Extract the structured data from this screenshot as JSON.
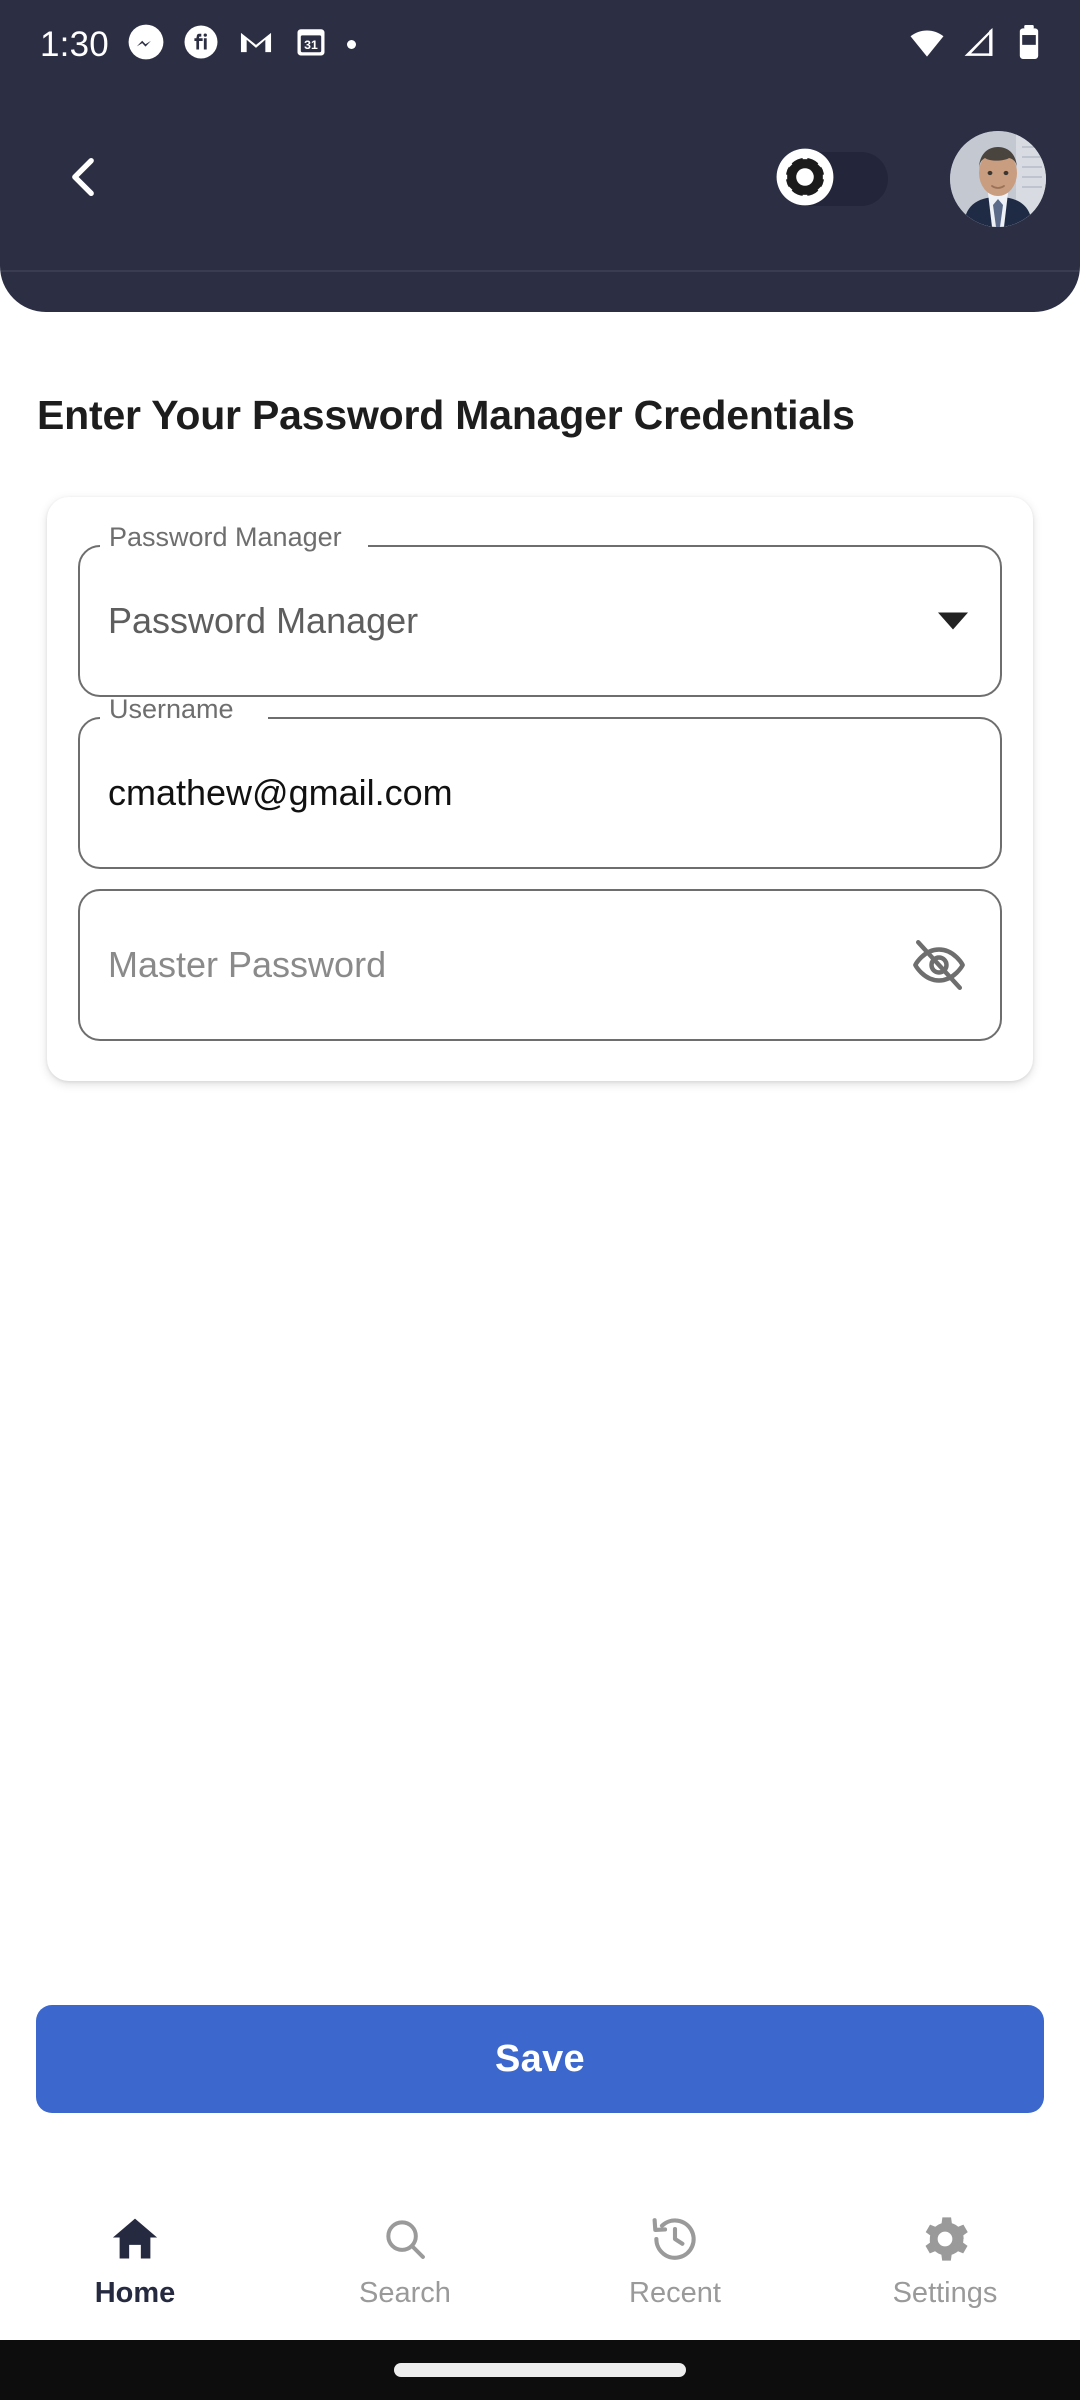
{
  "status_bar": {
    "time": "1:30",
    "left_icons": [
      {
        "name": "messenger-icon"
      },
      {
        "name": "fiverr-icon"
      },
      {
        "name": "gmail-icon"
      },
      {
        "name": "calendar-icon",
        "label": "31"
      },
      {
        "name": "more-notifications-dot-icon"
      }
    ],
    "right_icons": [
      {
        "name": "wifi-icon"
      },
      {
        "name": "cellular-signal-icon"
      },
      {
        "name": "battery-icon"
      }
    ]
  },
  "app_bar": {
    "back_icon": "chevron-left-icon",
    "theme_toggle": {
      "name": "theme-mode-toggle",
      "icon": "brightness-sun-icon",
      "state": "off",
      "track_color": "#23263a"
    },
    "avatar": {
      "name": "user-avatar",
      "alt": "User profile photo"
    },
    "background_color": "#2c2f44"
  },
  "main": {
    "page_title": "Enter Your Password Manager Credentials",
    "fields": [
      {
        "id": "password-manager",
        "label": "Password Manager",
        "value": "Password Manager",
        "type": "select",
        "value_style": "dim",
        "trailing_icon": "chevron-down-icon"
      },
      {
        "id": "username",
        "label": "Username",
        "value": "cmathew@gmail.com",
        "type": "text",
        "value_style": "dark",
        "trailing_icon": ""
      },
      {
        "id": "master-password",
        "label": "",
        "value": "Master Password",
        "placeholder": "Master Password",
        "type": "password",
        "value_style": "placeholder",
        "trailing_icon": "visibility-off-icon"
      }
    ]
  },
  "footer": {
    "save_label": "Save",
    "save_color": "#3c67cd"
  },
  "bottom_nav": {
    "active_index": 0,
    "items": [
      {
        "label": "Home",
        "icon": "home-icon"
      },
      {
        "label": "Search",
        "icon": "search-icon"
      },
      {
        "label": "Recent",
        "icon": "history-clock-icon"
      },
      {
        "label": "Settings",
        "icon": "gear-icon"
      }
    ]
  },
  "system_nav": {
    "home_indicator": "home-gesture-pill"
  }
}
